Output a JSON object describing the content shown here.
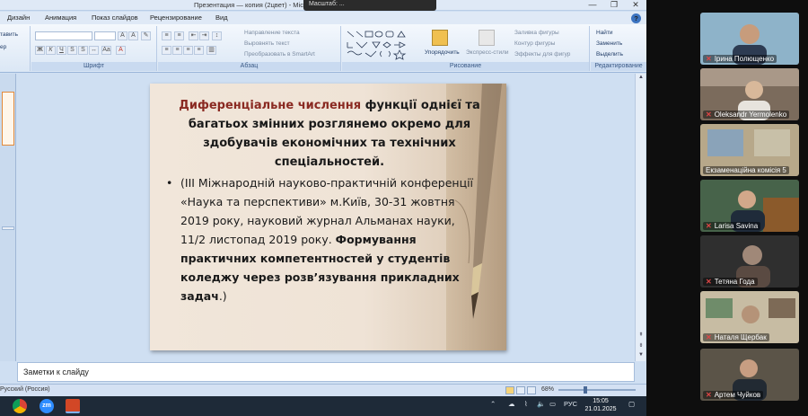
{
  "window": {
    "title": "Презентация — копия (2цвет) - Microsoft PowerPoint",
    "zoom_overlay": "Масштаб: ...",
    "controls": {
      "minimize": "—",
      "restore": "❐",
      "close": "✕"
    }
  },
  "ribbon_tabs": [
    {
      "label": "Дизайн"
    },
    {
      "label": "Анимация"
    },
    {
      "label": "Показ слайдов"
    },
    {
      "label": "Рецензирование"
    },
    {
      "label": "Вид"
    }
  ],
  "ribbon": {
    "clipboard": {
      "paste": "тавить",
      "cut": "ер"
    },
    "font_group": "Шрифт",
    "paragraph_group": "Абзац",
    "paragraph": {
      "text_direction": "Направление текста",
      "align_text": "Выровнять текст",
      "smartart": "Преобразовать в SmartArt"
    },
    "drawing_group": "Рисование",
    "drawing": {
      "arrange": "Упорядочить",
      "quick_styles": "Экспресс-стили",
      "shape_fill": "Заливка фигуры",
      "shape_outline": "Контур фигуры",
      "shape_effects": "Эффекты для фигур"
    },
    "editing_group": "Редактирование",
    "editing": {
      "find": "Найти",
      "replace": "Заменить",
      "select": "Выделить"
    }
  },
  "slide": {
    "title_accent": "Диференціальне числення",
    "title_rest": " функції однієї та багатьох змінних розглянемо окремо для здобувачів економічних та технічних спеціальностей.",
    "bullet_normal": "(ІІІ Міжнародній науково-практичній конференції «Наука та перспективи» м.Київ, 30-31 жовтня 2019 року, науковий журнал Альманах науки, 11/2 листопад 2019 року. ",
    "bullet_bold": "Формування практичних компетентностей у студентів коледжу через розв’язування прикладних задач",
    "bullet_end": ".)"
  },
  "notes": {
    "placeholder": "Заметки к слайду"
  },
  "statusbar": {
    "language": "Русский (Россия)",
    "zoom": "68%",
    "zoom_level": 0.68
  },
  "taskbar": {
    "apps": [
      {
        "name": "chrome-icon"
      },
      {
        "name": "zoom-icon",
        "label": "zm"
      },
      {
        "name": "powerpoint-icon"
      }
    ],
    "tray_lang": "РУС",
    "time": "15:05",
    "date": "21.01.2025"
  },
  "participants": [
    {
      "name": "Ірина Полющенко",
      "muted": true,
      "bg": "#7aa0b8"
    },
    {
      "name": "Oleksandr Yermolenko",
      "muted": true,
      "bg": "#8a7a6a"
    },
    {
      "name": "Екзаменаційна комісія 5",
      "muted": false,
      "bg": "#a99a78"
    },
    {
      "name": "Larisa Savina",
      "muted": true,
      "bg": "#5e7a5a"
    },
    {
      "name": "Тетяна Года",
      "muted": true,
      "bg": "#3b3b3b"
    },
    {
      "name": "Наталя Щербак",
      "muted": true,
      "bg": "#b3a58a"
    },
    {
      "name": "Артем Чуйков",
      "muted": true,
      "bg": "#5b5448"
    }
  ],
  "colors": {
    "accent_title": "#8a2a22",
    "muted_mic": "#e04545"
  }
}
